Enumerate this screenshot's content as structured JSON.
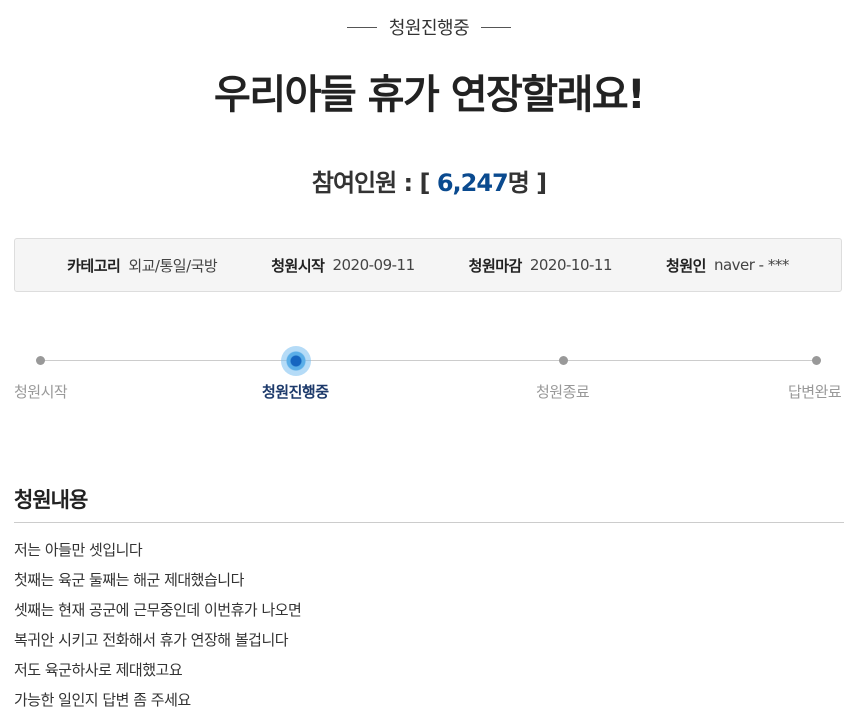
{
  "status": {
    "label": "청원진행중"
  },
  "petition": {
    "title": "우리아들 휴가 연장할래요!",
    "participants_prefix": "참여인원 : [ ",
    "participants_count": "6,247",
    "participants_suffix": "명 ]"
  },
  "info": [
    {
      "label": "카테고리",
      "value": "외교/통일/국방"
    },
    {
      "label": "청원시작",
      "value": "2020-09-11"
    },
    {
      "label": "청원마감",
      "value": "2020-10-11"
    },
    {
      "label": "청원인",
      "value": "naver - ***"
    }
  ],
  "progress": {
    "steps": [
      {
        "label": "청원시작"
      },
      {
        "label": "청원진행중"
      },
      {
        "label": "청원종료"
      },
      {
        "label": "답변완료"
      }
    ],
    "current_step": "청원진행중"
  },
  "content": {
    "heading": "청원내용",
    "lines": [
      "저는 아들만 셋입니다",
      "첫째는 육군 둘째는 해군 제대했습니다",
      "셋째는 현재 공군에 근무중인데 이번휴가 나오면",
      "복귀안 시키고 전화해서 휴가 연장해 볼겁니다",
      "저도 육군하사로 제대했고요",
      "가능한 일인지 답변 좀 주세요"
    ]
  },
  "colors": {
    "accent": "#0a4a8f",
    "active_step": "#1d3a6b",
    "inactive_step": "#999999"
  }
}
